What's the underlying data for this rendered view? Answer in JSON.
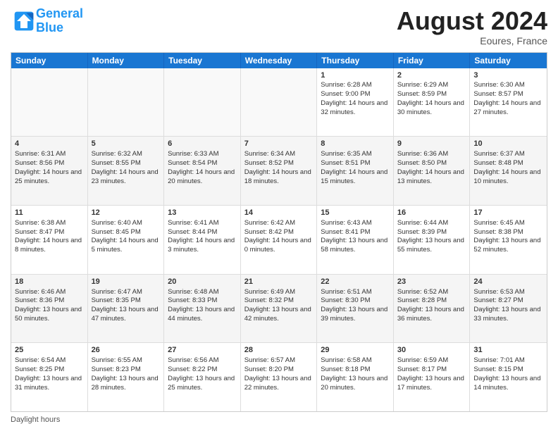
{
  "header": {
    "logo_line1": "General",
    "logo_line2": "Blue",
    "main_title": "August 2024",
    "subtitle": "Eoures, France"
  },
  "days_of_week": [
    "Sunday",
    "Monday",
    "Tuesday",
    "Wednesday",
    "Thursday",
    "Friday",
    "Saturday"
  ],
  "footer_label": "Daylight hours",
  "rows": [
    [
      {
        "day": "",
        "info": ""
      },
      {
        "day": "",
        "info": ""
      },
      {
        "day": "",
        "info": ""
      },
      {
        "day": "",
        "info": ""
      },
      {
        "day": "1",
        "info": "Sunrise: 6:28 AM\nSunset: 9:00 PM\nDaylight: 14 hours and 32 minutes."
      },
      {
        "day": "2",
        "info": "Sunrise: 6:29 AM\nSunset: 8:59 PM\nDaylight: 14 hours and 30 minutes."
      },
      {
        "day": "3",
        "info": "Sunrise: 6:30 AM\nSunset: 8:57 PM\nDaylight: 14 hours and 27 minutes."
      }
    ],
    [
      {
        "day": "4",
        "info": "Sunrise: 6:31 AM\nSunset: 8:56 PM\nDaylight: 14 hours and 25 minutes."
      },
      {
        "day": "5",
        "info": "Sunrise: 6:32 AM\nSunset: 8:55 PM\nDaylight: 14 hours and 23 minutes."
      },
      {
        "day": "6",
        "info": "Sunrise: 6:33 AM\nSunset: 8:54 PM\nDaylight: 14 hours and 20 minutes."
      },
      {
        "day": "7",
        "info": "Sunrise: 6:34 AM\nSunset: 8:52 PM\nDaylight: 14 hours and 18 minutes."
      },
      {
        "day": "8",
        "info": "Sunrise: 6:35 AM\nSunset: 8:51 PM\nDaylight: 14 hours and 15 minutes."
      },
      {
        "day": "9",
        "info": "Sunrise: 6:36 AM\nSunset: 8:50 PM\nDaylight: 14 hours and 13 minutes."
      },
      {
        "day": "10",
        "info": "Sunrise: 6:37 AM\nSunset: 8:48 PM\nDaylight: 14 hours and 10 minutes."
      }
    ],
    [
      {
        "day": "11",
        "info": "Sunrise: 6:38 AM\nSunset: 8:47 PM\nDaylight: 14 hours and 8 minutes."
      },
      {
        "day": "12",
        "info": "Sunrise: 6:40 AM\nSunset: 8:45 PM\nDaylight: 14 hours and 5 minutes."
      },
      {
        "day": "13",
        "info": "Sunrise: 6:41 AM\nSunset: 8:44 PM\nDaylight: 14 hours and 3 minutes."
      },
      {
        "day": "14",
        "info": "Sunrise: 6:42 AM\nSunset: 8:42 PM\nDaylight: 14 hours and 0 minutes."
      },
      {
        "day": "15",
        "info": "Sunrise: 6:43 AM\nSunset: 8:41 PM\nDaylight: 13 hours and 58 minutes."
      },
      {
        "day": "16",
        "info": "Sunrise: 6:44 AM\nSunset: 8:39 PM\nDaylight: 13 hours and 55 minutes."
      },
      {
        "day": "17",
        "info": "Sunrise: 6:45 AM\nSunset: 8:38 PM\nDaylight: 13 hours and 52 minutes."
      }
    ],
    [
      {
        "day": "18",
        "info": "Sunrise: 6:46 AM\nSunset: 8:36 PM\nDaylight: 13 hours and 50 minutes."
      },
      {
        "day": "19",
        "info": "Sunrise: 6:47 AM\nSunset: 8:35 PM\nDaylight: 13 hours and 47 minutes."
      },
      {
        "day": "20",
        "info": "Sunrise: 6:48 AM\nSunset: 8:33 PM\nDaylight: 13 hours and 44 minutes."
      },
      {
        "day": "21",
        "info": "Sunrise: 6:49 AM\nSunset: 8:32 PM\nDaylight: 13 hours and 42 minutes."
      },
      {
        "day": "22",
        "info": "Sunrise: 6:51 AM\nSunset: 8:30 PM\nDaylight: 13 hours and 39 minutes."
      },
      {
        "day": "23",
        "info": "Sunrise: 6:52 AM\nSunset: 8:28 PM\nDaylight: 13 hours and 36 minutes."
      },
      {
        "day": "24",
        "info": "Sunrise: 6:53 AM\nSunset: 8:27 PM\nDaylight: 13 hours and 33 minutes."
      }
    ],
    [
      {
        "day": "25",
        "info": "Sunrise: 6:54 AM\nSunset: 8:25 PM\nDaylight: 13 hours and 31 minutes."
      },
      {
        "day": "26",
        "info": "Sunrise: 6:55 AM\nSunset: 8:23 PM\nDaylight: 13 hours and 28 minutes."
      },
      {
        "day": "27",
        "info": "Sunrise: 6:56 AM\nSunset: 8:22 PM\nDaylight: 13 hours and 25 minutes."
      },
      {
        "day": "28",
        "info": "Sunrise: 6:57 AM\nSunset: 8:20 PM\nDaylight: 13 hours and 22 minutes."
      },
      {
        "day": "29",
        "info": "Sunrise: 6:58 AM\nSunset: 8:18 PM\nDaylight: 13 hours and 20 minutes."
      },
      {
        "day": "30",
        "info": "Sunrise: 6:59 AM\nSunset: 8:17 PM\nDaylight: 13 hours and 17 minutes."
      },
      {
        "day": "31",
        "info": "Sunrise: 7:01 AM\nSunset: 8:15 PM\nDaylight: 13 hours and 14 minutes."
      }
    ]
  ]
}
